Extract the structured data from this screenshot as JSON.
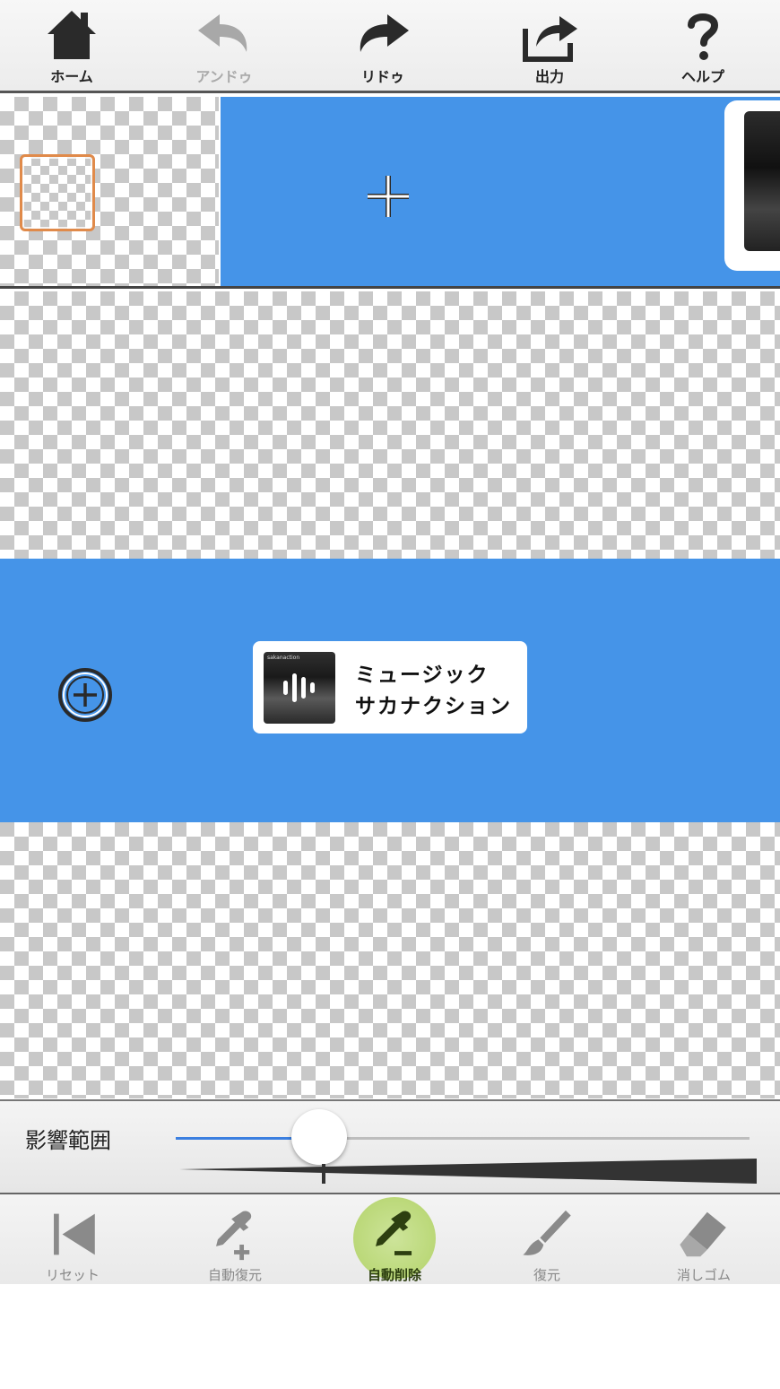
{
  "toolbar": {
    "home_label": "ホーム",
    "undo_label": "アンドゥ",
    "redo_label": "リドゥ",
    "export_label": "出力",
    "help_label": "ヘルプ"
  },
  "music_card": {
    "title": "ミュージック",
    "artist": "サカナクション",
    "album_tag": "sakanaction"
  },
  "range_panel": {
    "label": "影響範囲",
    "value_fraction": 0.25
  },
  "bottom_toolbar": {
    "reset_label": "リセット",
    "auto_restore_label": "自動復元",
    "auto_erase_label": "自動削除",
    "restore_label": "復元",
    "eraser_label": "消しゴム",
    "active_tool": "auto_erase"
  },
  "colors": {
    "accent_blue": "#4594e8",
    "selection_orange": "#e08a4a",
    "active_tool_green": "#b3d36a",
    "slider_blue": "#3b7fe0"
  },
  "icons": {
    "home": "home-icon",
    "undo": "undo-arrow-icon",
    "redo": "redo-arrow-icon",
    "export": "share-export-icon",
    "help": "question-mark-icon",
    "reset": "skip-to-start-icon",
    "auto_restore": "dropper-plus-icon",
    "auto_erase": "dropper-minus-icon",
    "restore": "brush-icon",
    "eraser": "eraser-icon"
  }
}
